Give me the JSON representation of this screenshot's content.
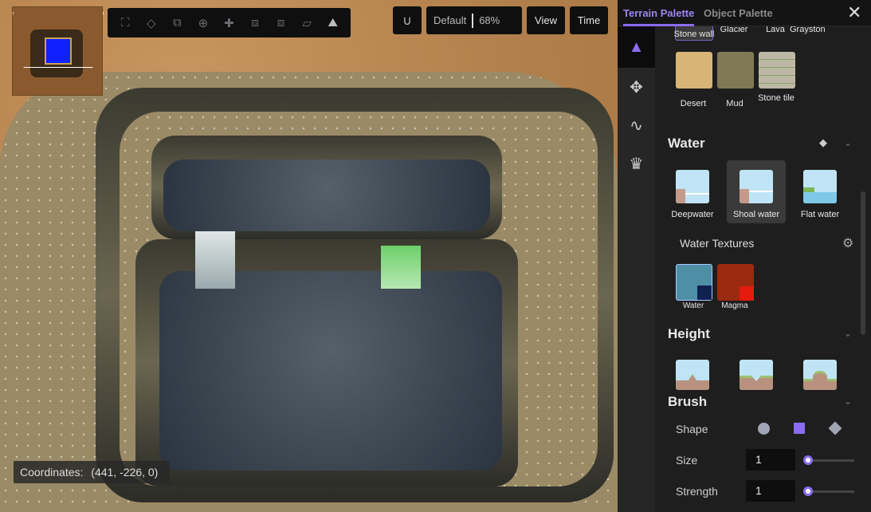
{
  "toolbar": {
    "icons": [
      "fullscreen-icon",
      "transform-icon",
      "layers-icon",
      "target-icon",
      "puzzle-icon",
      "copy-icon",
      "paste-icon",
      "ruler-icon",
      "terrain-icon"
    ],
    "snap_icon": "magnet-icon",
    "preset": "Default",
    "zoom": "68%",
    "view_label": "View",
    "time_label": "Time"
  },
  "status": {
    "coordinates_label": "Coordinates:",
    "coordinates_value": "(441, -226, 0)"
  },
  "sidebar": {
    "tabs": [
      {
        "label": "Terrain Palette",
        "active": true
      },
      {
        "label": "Object Palette",
        "active": false
      }
    ],
    "close_icon": "close-icon",
    "rail": [
      "terrain-icon",
      "tiles-icon",
      "path-icon",
      "crown-icon"
    ],
    "textures_top": [
      "Stone wall",
      "Glacier",
      "Lava",
      "Grayston"
    ],
    "textures": [
      {
        "label": "Desert",
        "color": "#d8b577"
      },
      {
        "label": "Mud",
        "color": "#7f7a55"
      },
      {
        "label": "Stone tile",
        "color": "#bdb8a5"
      }
    ],
    "water": {
      "title": "Water",
      "items": [
        {
          "label": "Deepwater"
        },
        {
          "label": "Shoal water",
          "selected": true
        },
        {
          "label": "Flat water"
        }
      ],
      "textures_title": "Water Textures",
      "textures": [
        {
          "label": "Water",
          "color": "#4f8fa6",
          "swatch": "#10204f"
        },
        {
          "label": "Magma",
          "color": "#9a2a10",
          "swatch": "#e51b0d"
        }
      ]
    },
    "height": {
      "title": "Height"
    },
    "brush": {
      "title": "Brush",
      "shape_label": "Shape",
      "shapes": [
        "circle",
        "square",
        "diamond"
      ],
      "selected_shape": "square",
      "size_label": "Size",
      "size": "1",
      "strength_label": "Strength",
      "strength": "1"
    }
  },
  "colors": {
    "accent": "#8a6cf0"
  }
}
